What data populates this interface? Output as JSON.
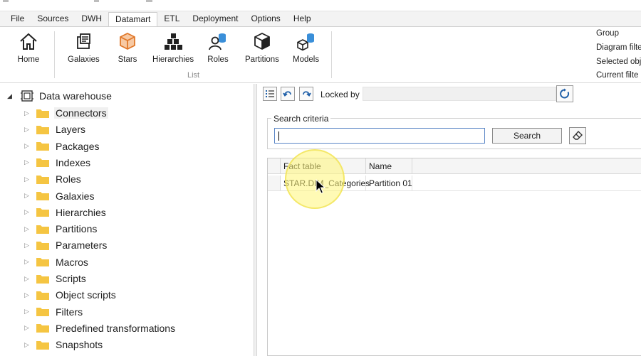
{
  "menu": {
    "items": [
      "File",
      "Sources",
      "DWH",
      "Datamart",
      "ETL",
      "Deployment",
      "Options",
      "Help"
    ],
    "active_index": 3
  },
  "ribbon": {
    "buttons": [
      {
        "label": "Home",
        "icon": "home-icon"
      },
      {
        "label": "Galaxies",
        "icon": "galaxies-icon"
      },
      {
        "label": "Stars",
        "icon": "star-cube-icon"
      },
      {
        "label": "Hierarchies",
        "icon": "hierarchies-icon"
      },
      {
        "label": "Roles",
        "icon": "roles-icon"
      },
      {
        "label": "Partitions",
        "icon": "partitions-icon"
      },
      {
        "label": "Models",
        "icon": "models-icon"
      }
    ],
    "group_label": "List",
    "side_items": [
      "Group",
      "Diagram filte",
      "Selected obj",
      "Current filte"
    ]
  },
  "tree": {
    "root_label": "Data warehouse",
    "items": [
      "Connectors",
      "Layers",
      "Packages",
      "Indexes",
      "Roles",
      "Galaxies",
      "Hierarchies",
      "Partitions",
      "Parameters",
      "Macros",
      "Scripts",
      "Object scripts",
      "Filters",
      "Predefined transformations",
      "Snapshots"
    ],
    "selected_index": 0
  },
  "toolbar": {
    "locked_by_label": "Locked by",
    "locked_by_value": ""
  },
  "search": {
    "group_title": "Search criteria",
    "input_value": "",
    "button_label": "Search"
  },
  "grid": {
    "columns": [
      "Fact table",
      "Name"
    ],
    "rows": [
      [
        "STAR.DIM_Categories",
        "Partition 01"
      ]
    ]
  },
  "colors": {
    "accent_blue": "#2f6fb4",
    "folder_yellow": "#f5c542",
    "star_orange": "#e0782a"
  }
}
